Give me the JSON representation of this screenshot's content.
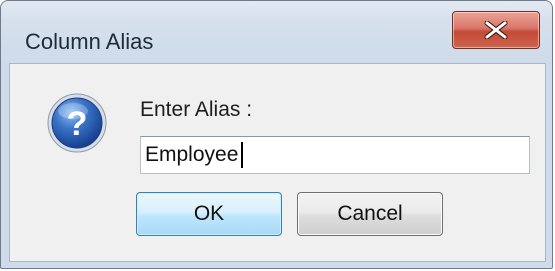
{
  "dialog": {
    "title": "Column Alias",
    "close_icon": "close-icon",
    "question_icon": "question-mark-icon",
    "prompt_label": "Enter Alias :",
    "alias_value": "Employee",
    "ok_label": "OK",
    "cancel_label": "Cancel"
  },
  "colors": {
    "close_button": "#c24a36",
    "question_icon": "#2f5fb0",
    "default_button_border": "#3c7fb1"
  }
}
